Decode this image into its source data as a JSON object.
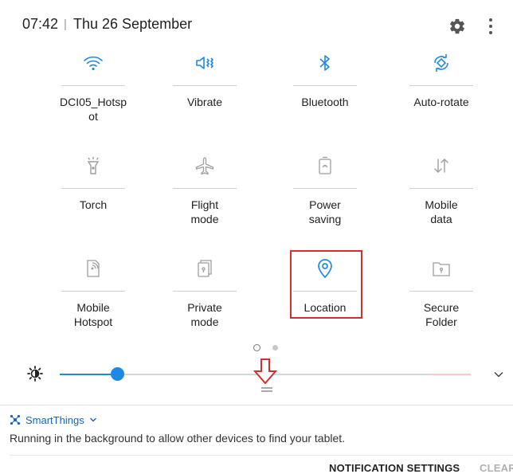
{
  "status": {
    "time": "07:42",
    "separator": "|",
    "date": "Thu 26 September"
  },
  "tiles": [
    {
      "label": "DCI05_Hotsp\not",
      "icon": "wifi-icon",
      "active": true
    },
    {
      "label": "Vibrate",
      "icon": "vibrate-icon",
      "active": true
    },
    {
      "label": "Bluetooth",
      "icon": "bluetooth-icon",
      "active": true
    },
    {
      "label": "Auto-rotate",
      "icon": "auto-rotate-icon",
      "active": true
    },
    {
      "label": "Torch",
      "icon": "torch-icon",
      "active": false
    },
    {
      "label": "Flight\nmode",
      "icon": "airplane-icon",
      "active": false
    },
    {
      "label": "Power\nsaving",
      "icon": "battery-icon",
      "active": false
    },
    {
      "label": "Mobile\ndata",
      "icon": "mobile-data-icon",
      "active": false
    },
    {
      "label": "Mobile\nHotspot",
      "icon": "hotspot-icon",
      "active": false
    },
    {
      "label": "Private\nmode",
      "icon": "private-mode-icon",
      "active": false
    },
    {
      "label": "Location",
      "icon": "location-icon",
      "active": true
    },
    {
      "label": "Secure\nFolder",
      "icon": "secure-folder-icon",
      "active": false
    }
  ],
  "brightness": {
    "level": 0.14
  },
  "notification": {
    "app": "SmartThings",
    "text": "Running in the background to allow other devices to find your tablet."
  },
  "footer": {
    "settings_label": "NOTIFICATION SETTINGS",
    "clear_label": "CLEAR"
  },
  "colors": {
    "active": "#1e88e5",
    "inactive": "#9e9e9e",
    "highlight": "#d32f2f"
  }
}
